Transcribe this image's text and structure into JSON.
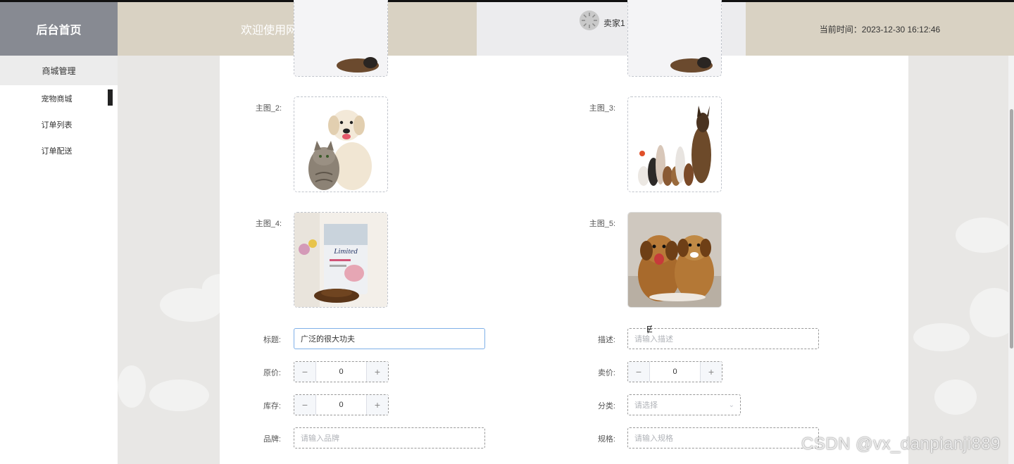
{
  "header": {
    "brand": "后台首页",
    "welcome": "欢迎使用网上宠物商店",
    "user": "卖家1",
    "time": "当前时间：2023-12-30 16:12:46"
  },
  "sidebar": {
    "group": "商城管理",
    "items": [
      {
        "label": "宠物商城",
        "active": true
      },
      {
        "label": "订单列表",
        "active": false
      },
      {
        "label": "订单配送",
        "active": false
      }
    ]
  },
  "form": {
    "images": [
      {
        "label": "主图_2:",
        "subject": "puppy and kitten"
      },
      {
        "label": "主图_3:",
        "subject": "group of cats and dogs"
      },
      {
        "label": "主图_4:",
        "subject": "cat food bag",
        "bag_text": "Limited"
      },
      {
        "label": "主图_5:",
        "subject": "two puppies"
      }
    ],
    "title": {
      "label": "标题:",
      "value": "广泛的很大功夫"
    },
    "description": {
      "label": "描述:",
      "placeholder": "请输入描述"
    },
    "original_price": {
      "label": "原价:",
      "value": "0",
      "minus": "−",
      "plus": "+"
    },
    "sale_price": {
      "label": "卖价:",
      "value": "0",
      "minus": "−",
      "plus": "+"
    },
    "stock": {
      "label": "库存:",
      "value": "0",
      "minus": "−",
      "plus": "+"
    },
    "category": {
      "label": "分类:",
      "placeholder": "请选择"
    },
    "brand": {
      "label": "品牌:",
      "placeholder": "请输入品牌"
    },
    "spec": {
      "label": "规格:",
      "placeholder": "请输入规格"
    }
  },
  "watermark": "CSDN @vx_danpianji889",
  "colors": {
    "header_tan": "#d9d2c3",
    "brand_gray": "#878a92",
    "focus_blue": "#7fb0e8"
  }
}
